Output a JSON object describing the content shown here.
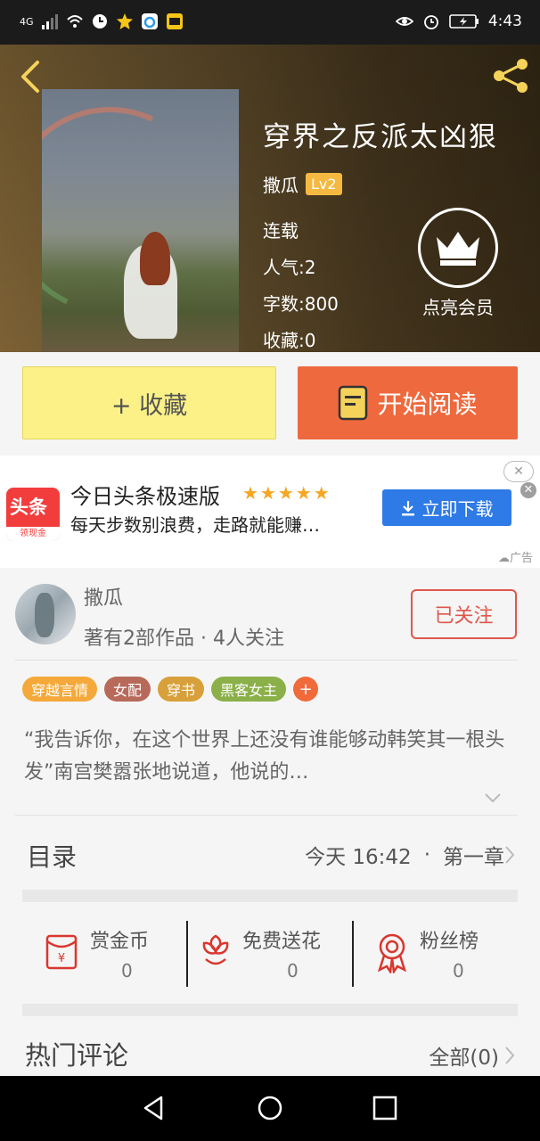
{
  "status_bar": {
    "network": "4G",
    "time": "4:43"
  },
  "book": {
    "title": "穿界之反派太凶狠",
    "author": "撒瓜",
    "level": "Lv2",
    "status": "连载",
    "popularity": "人气:2",
    "word_count": "字数:800",
    "favorites": "收藏:0",
    "vip_label": "点亮会员"
  },
  "actions": {
    "collect_label": "+ 收藏",
    "read_label": "开始阅读"
  },
  "ad": {
    "logo_main": "头条",
    "logo_sub": "领现金",
    "title": "今日头条极速版",
    "stars": "★★★★★",
    "description": "每天步数别浪费，走路就能赚…",
    "download_label": "立即下载",
    "close_label": "✕",
    "tag": "广告"
  },
  "author_card": {
    "name": "撒瓜",
    "meta": "著有2部作品 · 4人关注",
    "follow_label": "已关注"
  },
  "tags": [
    {
      "label": "穿越言情",
      "color": "#f4a93a"
    },
    {
      "label": "女配",
      "color": "#b76a5a"
    },
    {
      "label": "穿书",
      "color": "#d8a03a"
    },
    {
      "label": "黑客女主",
      "color": "#8bb04a"
    }
  ],
  "tag_more": "+",
  "synopsis": "“我告诉你，在这个世界上还没有谁能够动韩笑其一根头发”南宫樊嚣张地说道，他说的…",
  "toc": {
    "title": "目录",
    "updated": "今天 16:42",
    "separator": "·",
    "latest_chapter": "第一章"
  },
  "rewards": [
    {
      "label": "赏金币",
      "value": "0",
      "icon": "red-envelope-icon"
    },
    {
      "label": "免费送花",
      "value": "0",
      "icon": "flower-icon"
    },
    {
      "label": "粉丝榜",
      "value": "0",
      "icon": "medal-icon"
    }
  ],
  "hot_comments": {
    "title": "热门评论",
    "all_label": "全部(0)"
  },
  "colors": {
    "accent_orange": "#ee6a3e",
    "collect_yellow": "#fbf187",
    "follow_red": "#e0574c",
    "ad_blue": "#2e7ae6"
  }
}
